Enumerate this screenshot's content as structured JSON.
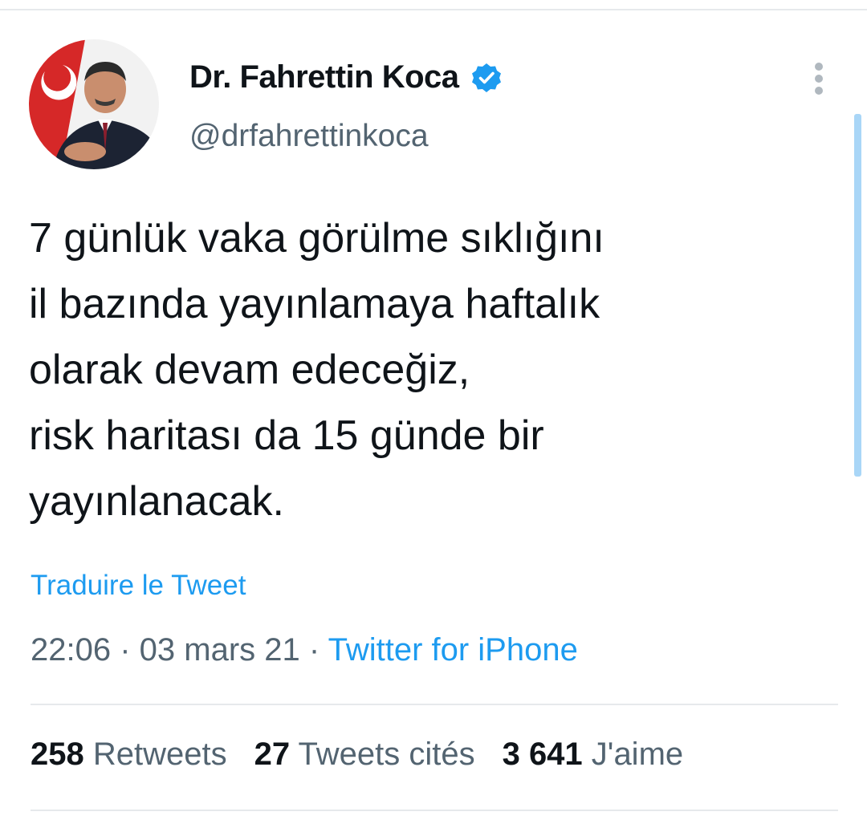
{
  "author": {
    "display_name": "Dr. Fahrettin Koca",
    "handle": "@drfahrettinkoca",
    "verified_icon": "verified-badge-icon"
  },
  "menu": {
    "more_icon": "more-vertical-icon"
  },
  "tweet": {
    "text": "7 günlük vaka görülme sıklığını\nil bazında yayınlamaya haftalık\nolarak devam edeceğiz,\nrisk haritası da 15 günde bir\nyayınlanacak.",
    "translate_label": "Traduire le Tweet",
    "time": "22:06",
    "date": "03 mars 21",
    "separator": " · ",
    "source": "Twitter for iPhone"
  },
  "stats": {
    "retweets_count": "258",
    "retweets_label": " Retweets",
    "quotes_count": "27",
    "quotes_label": " Tweets cités",
    "likes_count": "3 641",
    "likes_label": " J'aime"
  },
  "colors": {
    "accent": "#1d9bf0",
    "text_primary": "#0f1419",
    "text_secondary": "#536471",
    "divider": "#e6e9ec"
  }
}
